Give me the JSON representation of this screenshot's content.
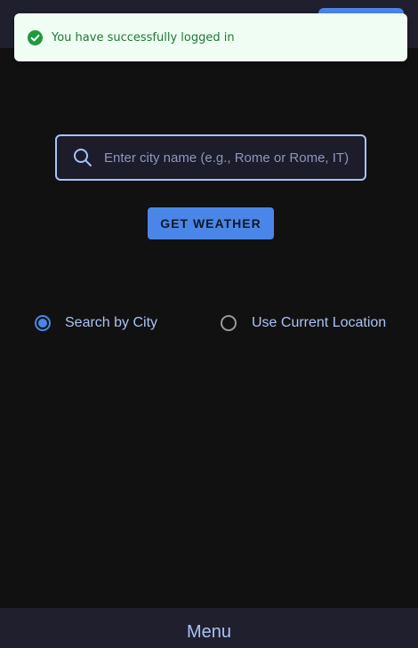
{
  "toast": {
    "message": "You have successfully logged in",
    "icon": "check-circle-icon",
    "color": "#1e7a36"
  },
  "search": {
    "placeholder": "Enter city name (e.g., Rome or Rome, IT)",
    "value": "",
    "icon": "search-icon"
  },
  "actions": {
    "get_weather_label": "GET WEATHER"
  },
  "mode": {
    "options": [
      {
        "label": "Search by City",
        "selected": true
      },
      {
        "label": "Use Current Location",
        "selected": false
      }
    ]
  },
  "footer": {
    "menu_label": "Menu"
  },
  "colors": {
    "accent": "#4a86e8",
    "background": "#111112",
    "bar": "#1f1f2e",
    "text_light": "#a9c3f5"
  }
}
